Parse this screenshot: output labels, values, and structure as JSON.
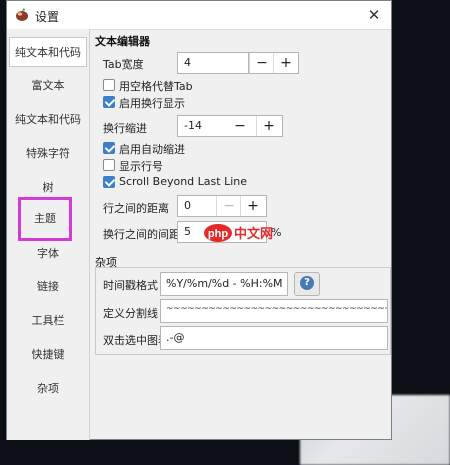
{
  "window": {
    "title": "设置"
  },
  "sidebar": {
    "items": [
      {
        "label": "纯文本和代码"
      },
      {
        "label": "富文本"
      },
      {
        "label": "纯文本和代码"
      },
      {
        "label": "特殊字符"
      },
      {
        "label": "树"
      },
      {
        "label": "主题"
      },
      {
        "label": "字体"
      },
      {
        "label": "链接"
      },
      {
        "label": "工具栏"
      },
      {
        "label": "快捷键"
      },
      {
        "label": "杂项"
      }
    ]
  },
  "editor": {
    "section_title": "文本编辑器",
    "tab_width_label": "Tab宽度",
    "tab_width_value": "4",
    "use_spaces_label": "用空格代替Tab",
    "word_wrap_label": "启用换行显示",
    "wrap_indent_label": "换行缩进",
    "wrap_indent_value": "-14",
    "auto_indent_label": "启用自动缩进",
    "line_numbers_label": "显示行号",
    "scroll_beyond_label": "Scroll Beyond Last Line",
    "line_spacing_label": "行之间的距离",
    "line_spacing_value": "0",
    "wrap_spacing_label": "换行之间的间距",
    "wrap_spacing_value": "5",
    "wrap_spacing_unit": "%",
    "minus": "−",
    "plus": "+"
  },
  "misc": {
    "section_title": "杂项",
    "timestamp_label": "时间戳格式",
    "timestamp_value": "%Y/%m/%d - %H:%M",
    "help_glyph": "?",
    "separator_label": "定义分割线",
    "separator_value": "~~~~~~~~~~~~~~~~~~~~~~~~~~~~~~~~~~~~~~~~~~~~",
    "dblclick_label": "双击选中图表",
    "dblclick_value": ".-@"
  },
  "watermark": {
    "php": "php",
    "cn": "中文网"
  },
  "colors": {
    "highlight": "#d63ad6",
    "checkbox": "#3c7fc8",
    "help": "#4a78b5"
  },
  "icons": {
    "app": "leaf-app-icon",
    "close": "close-icon"
  }
}
